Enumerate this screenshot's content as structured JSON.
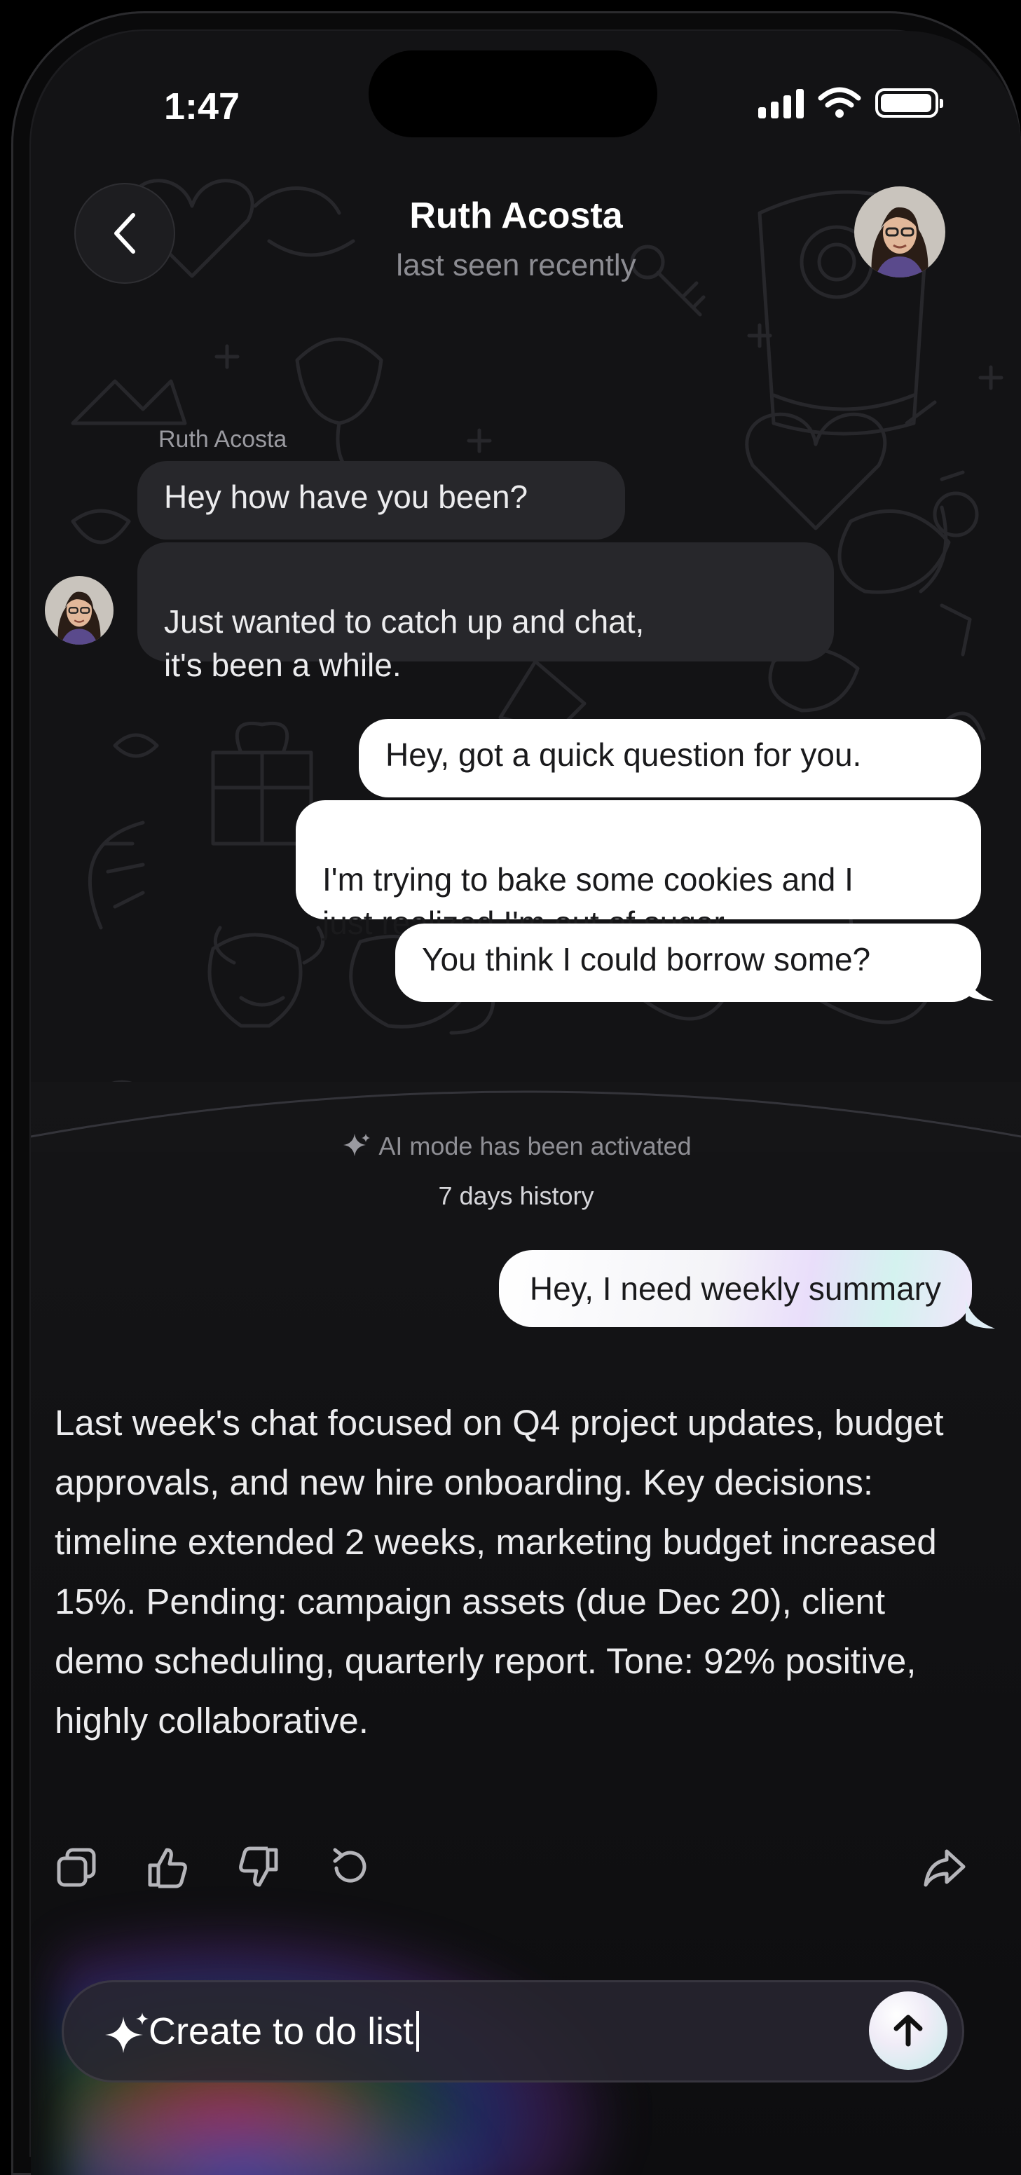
{
  "status_bar": {
    "time": "1:47"
  },
  "header": {
    "name": "Ruth Acosta",
    "status": "last seen recently"
  },
  "messages": [
    {
      "side": "in",
      "sender": "Ruth Acosta",
      "text": "Hey how have you been?"
    },
    {
      "side": "in",
      "text": "Just wanted to catch up and chat,\nit's been a while."
    },
    {
      "side": "out",
      "text": "Hey, got a quick question for you."
    },
    {
      "side": "out",
      "text": "I'm trying to bake some cookies and I\njust realized I'm out of sugar."
    },
    {
      "side": "out",
      "text": "You think I could borrow some?"
    }
  ],
  "ai": {
    "activated_text": "AI mode has been activated",
    "history_text": "7 days history",
    "user_prompt": "Hey, I need weekly summary",
    "summary": "Last week's chat focused on Q4 project updates, budget approvals, and new hire onboarding. Key decisions: timeline extended 2 weeks, marketing budget increased 15%. Pending: campaign assets (due Dec 20), client demo scheduling, quarterly report. Tone: 92% positive, highly collaborative."
  },
  "actions": [
    "copy-icon",
    "thumbs-up-icon",
    "thumbs-down-icon",
    "regenerate-icon",
    "share-icon"
  ],
  "composer": {
    "value": "Create to do list"
  },
  "colors": {
    "background": "#131315",
    "incoming_bubble": "#27272b",
    "outgoing_bubble": "#ffffff",
    "muted_text": "#8c8c92"
  }
}
